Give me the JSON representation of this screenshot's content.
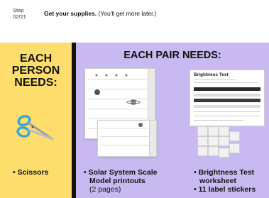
{
  "header": {
    "step_label": "Step",
    "step_number": "02/21",
    "instruction": "Get your supplies.",
    "instruction_note": "(You'll get more later.)"
  },
  "left_panel": {
    "title_lines": [
      "EACH",
      "PERSON",
      "NEEDS:"
    ],
    "item": "• Scissors",
    "icon": "scissors-icon",
    "background": "#fddd6b"
  },
  "right_panel": {
    "title": "EACH PAIR NEEDS:",
    "background": "#c8baf1",
    "items": [
      {
        "lines": [
          "• Solar System Scale",
          "Model printouts"
        ],
        "sub": "(2 pages)"
      },
      {
        "lines": [
          "• Brightness Test",
          "worksheet"
        ]
      },
      {
        "lines": [
          "• 11 label stickers"
        ]
      }
    ],
    "worksheet_title": "Brightness Test"
  },
  "colors": {
    "divider": "#111111",
    "scissors_handle": "#3aa6d6",
    "text": "#111111"
  }
}
